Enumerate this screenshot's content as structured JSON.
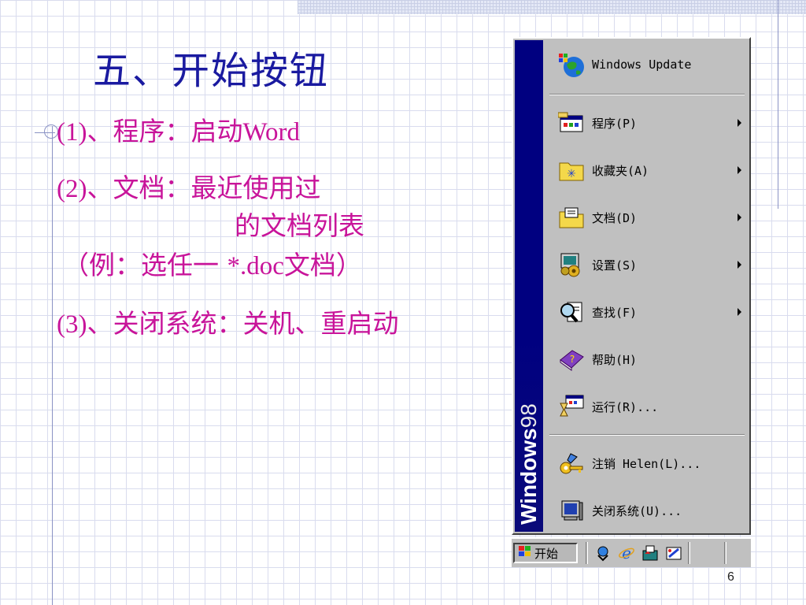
{
  "slide": {
    "title": "五、开始按钮",
    "bullets": [
      {
        "prefix": "(1)",
        "text": "、程序：启动",
        "suffix": "Word"
      },
      {
        "prefix": "(2)",
        "text": "、文档：最近使用过"
      },
      {
        "text": "的文档列表"
      },
      {
        "text": "（例：选任一 ",
        "mid": "*.doc",
        "suffix": "文档）"
      },
      {
        "prefix": "(3)",
        "text": "、关闭系统：关机、重启动"
      }
    ],
    "page_number": "6",
    "colors": {
      "title": "#1a1aa0",
      "bullet": "#c8149a"
    }
  },
  "start_menu": {
    "banner": {
      "bold": "Windows",
      "thin": "98"
    },
    "items": [
      {
        "label": "Windows Update",
        "icon": "windows-update-icon",
        "submenu": false
      },
      {
        "label": "程序(P)",
        "icon": "programs-icon",
        "submenu": true
      },
      {
        "label": "收藏夹(A)",
        "icon": "favorites-icon",
        "submenu": true
      },
      {
        "label": "文档(D)",
        "icon": "documents-icon",
        "submenu": true
      },
      {
        "label": "设置(S)",
        "icon": "settings-icon",
        "submenu": true
      },
      {
        "label": "查找(F)",
        "icon": "find-icon",
        "submenu": true
      },
      {
        "label": "帮助(H)",
        "icon": "help-icon",
        "submenu": false
      },
      {
        "label": "运行(R)...",
        "icon": "run-icon",
        "submenu": false
      },
      {
        "label": "注销 Helen(L)...",
        "icon": "logoff-icon",
        "submenu": false
      },
      {
        "label": "关闭系统(U)...",
        "icon": "shutdown-icon",
        "submenu": false
      }
    ]
  },
  "taskbar": {
    "start_label": "开始",
    "quick_launch": [
      "outlook-express-icon",
      "internet-explorer-icon",
      "show-desktop-icon",
      "channels-icon"
    ]
  }
}
